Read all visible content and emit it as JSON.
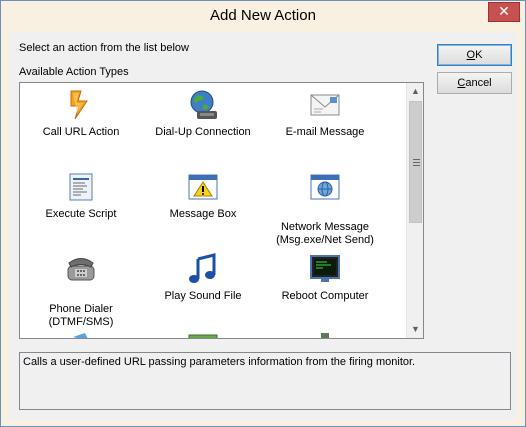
{
  "window": {
    "title": "Add New Action",
    "close_glyph": "✕"
  },
  "labels": {
    "instruction": "Select an action from the list below",
    "available": "Available Action Types"
  },
  "buttons": {
    "ok": "OK",
    "cancel": "Cancel"
  },
  "actions": [
    {
      "label": "Call URL Action",
      "icon": "lightning-icon",
      "selected": true
    },
    {
      "label": "Dial-Up Connection",
      "icon": "globe-phone-icon"
    },
    {
      "label": "E-mail Message",
      "icon": "envelope-icon"
    },
    {
      "label": "Execute Script",
      "icon": "script-icon"
    },
    {
      "label": "Message Box",
      "icon": "warning-window-icon"
    },
    {
      "label": "Network Message\n(Msg.exe/Net Send)",
      "icon": "network-window-icon"
    },
    {
      "label": "Phone Dialer\n(DTMF/SMS)",
      "icon": "telephone-icon"
    },
    {
      "label": "Play Sound File",
      "icon": "music-note-icon"
    },
    {
      "label": "Reboot Computer",
      "icon": "monitor-icon"
    }
  ],
  "description": "Calls a user-defined URL passing parameters information from the firing monitor.",
  "colors": {
    "window_bg": "#f8f0e0",
    "client_bg": "#f0f0f0",
    "close_button": "#c75050",
    "default_button_border": "#3c7fb1"
  }
}
